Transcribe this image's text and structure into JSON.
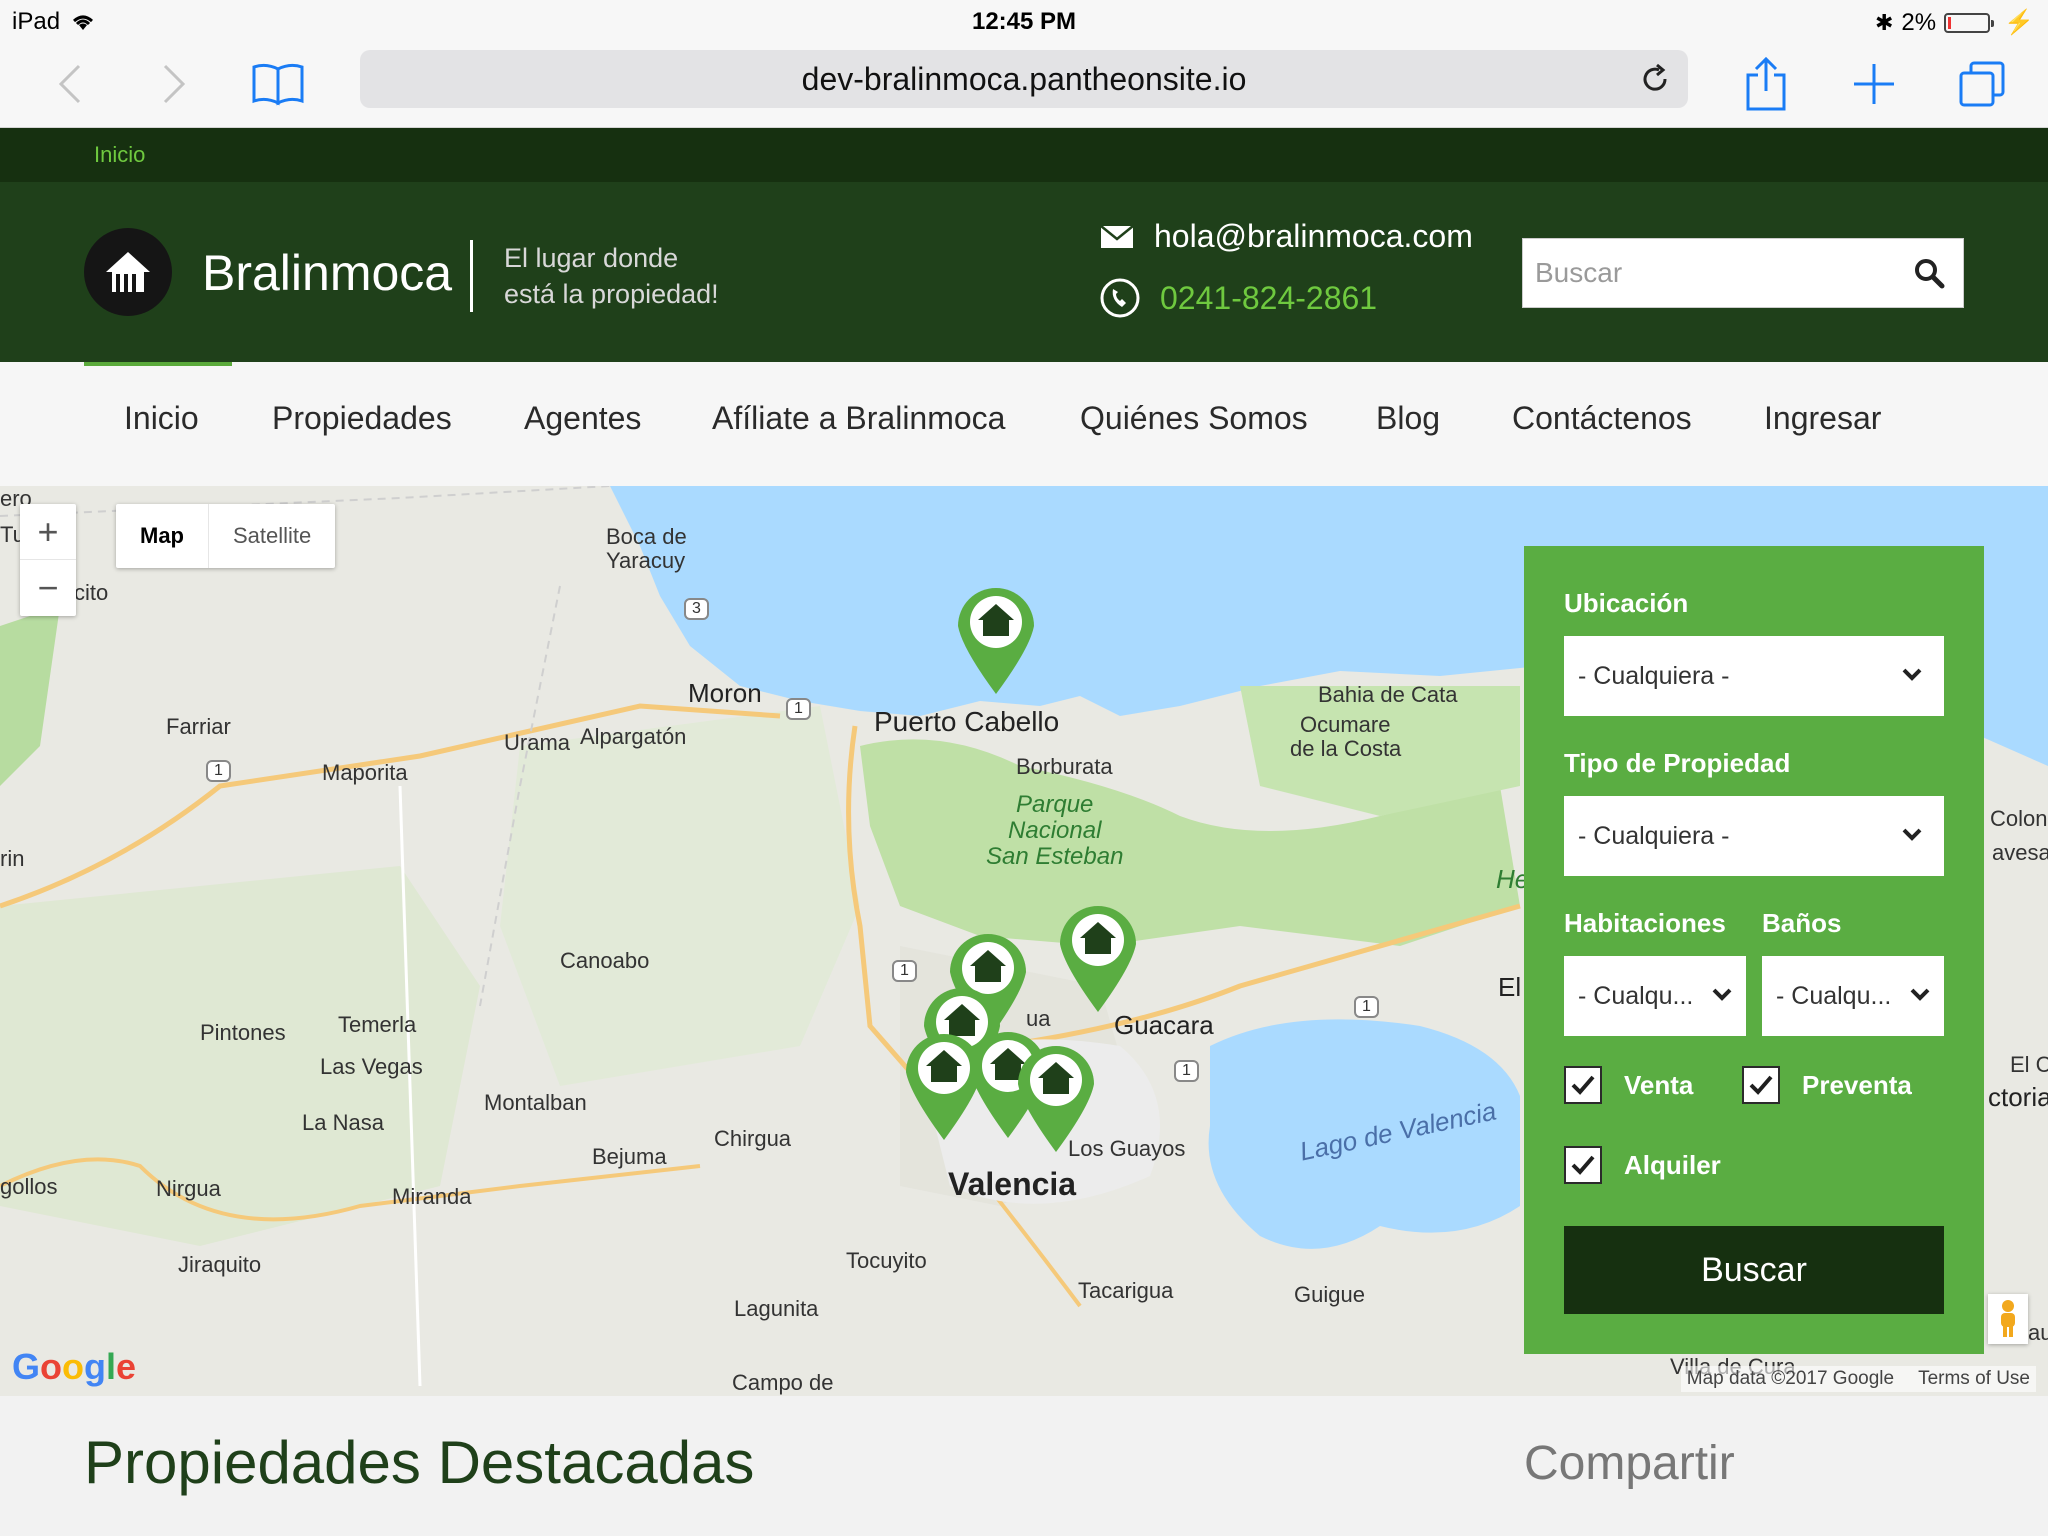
{
  "status_bar": {
    "device": "iPad",
    "time": "12:45 PM",
    "battery": "2%"
  },
  "browser": {
    "url": "dev-bralinmoca.pantheonsite.io",
    "icons": [
      "back-icon",
      "forward-icon",
      "bookmarks-icon",
      "reload-icon",
      "share-icon",
      "new-tab-icon",
      "tabs-icon"
    ]
  },
  "top_strip": {
    "link": "Inicio"
  },
  "header": {
    "brand": "Bralinmoca",
    "tagline_line1": "El lugar donde",
    "tagline_line2": "está la propiedad!",
    "email": "hola@bralinmoca.com",
    "phone": "0241-824-2861",
    "search_placeholder": "Buscar"
  },
  "nav": {
    "items": [
      "Inicio",
      "Propiedades",
      "Agentes",
      "Afíliate a Bralinmoca",
      "Quiénes Somos",
      "Blog",
      "Contáctenos",
      "Ingresar"
    ]
  },
  "map": {
    "type_map": "Map",
    "type_satellite": "Satellite",
    "zoom_in": "+",
    "zoom_out": "−",
    "labels": {
      "ero": "ero",
      "tur": "Tur",
      "cito": "cito",
      "boca": "Boca de",
      "yaracuy": "Yaracuy",
      "moron": "Moron",
      "puerto_cabello": "Puerto Cabello",
      "borburata": "Borburata",
      "parque": "Parque",
      "nacional": "Nacional",
      "san_esteban": "San Esteban",
      "bahia": "Bahia de Cata",
      "ocumare": "Ocumare",
      "costa": "de la Costa",
      "farriar": "Farriar",
      "urama": "Urama",
      "alpargaton": "Alpargatón",
      "maporita": "Maporita",
      "rin": "rin",
      "canoabo": "Canoabo",
      "pintones": "Pintones",
      "temerla": "Temerla",
      "las_vegas": "Las Vegas",
      "la_nasa": "La Nasa",
      "montalban": "Montalban",
      "chirgua": "Chirgua",
      "bejuma": "Bejuma",
      "miranda": "Miranda",
      "nirgua": "Nirgua",
      "gollos": "gollos",
      "jiraquito": "Jiraquito",
      "guacara": "Guacara",
      "los_guayos": "Los Guayos",
      "valencia": "Valencia",
      "lago": "Lago de Valencia",
      "tocuyito": "Tocuyito",
      "lagunita": "Lagunita",
      "campo": "Campo de",
      "tacarigua": "Tacarigua",
      "guigue": "Guigue",
      "villa": "Villa de Cura",
      "el": "El",
      "he": "He",
      "colonia": "Colonia",
      "avesac": "avesac",
      "el_c": "El C",
      "ctoria": "ctoria",
      "au": "au",
      "ua": "ua"
    },
    "route_shields": [
      "3",
      "1",
      "1",
      "1",
      "1",
      "1"
    ],
    "logo": "Google",
    "map_data": "Map data ©2017 Google",
    "terms": "Terms of Use"
  },
  "filters": {
    "location_label": "Ubicación",
    "location_value": "- Cualquiera -",
    "type_label": "Tipo de Propiedad",
    "type_value": "- Cualquiera -",
    "rooms_label": "Habitaciones",
    "rooms_value": "- Cualqu...",
    "baths_label": "Baños",
    "baths_value": "- Cualqu...",
    "venta": "Venta",
    "preventa": "Preventa",
    "alquiler": "Alquiler",
    "button": "Buscar"
  },
  "featured_title": "Propiedades Destacadas",
  "share_title": "Compartir",
  "colors": {
    "brand_dark": "#1f401a",
    "brand_green": "#5aad42",
    "accent_text": "#6fc93f"
  }
}
